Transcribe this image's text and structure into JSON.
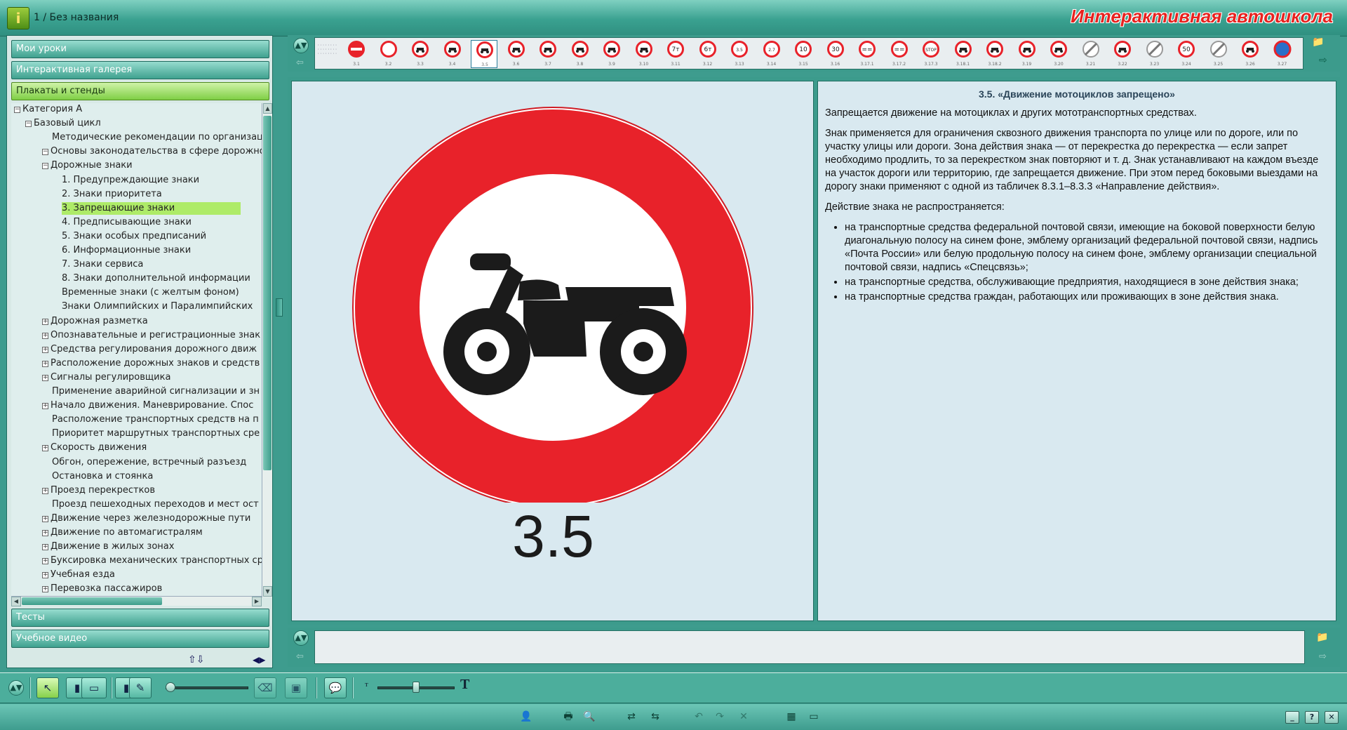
{
  "window": {
    "title": "1 / Без названия",
    "brand": "Интерактивная автошкола"
  },
  "sidebar": {
    "buttons": [
      {
        "label": "Мои уроки"
      },
      {
        "label": "Интерактивная галерея"
      },
      {
        "label": "Плакаты и стенды"
      }
    ],
    "bottom_buttons": [
      {
        "label": "Тесты"
      },
      {
        "label": "Учебное видео"
      }
    ],
    "tree": [
      {
        "label": "Категория A",
        "level": 0,
        "toggle": "minus"
      },
      {
        "label": "Базовый цикл",
        "level": 1,
        "toggle": "minus"
      },
      {
        "label": "Методические рекомендации по организации",
        "level": 2,
        "toggle": ""
      },
      {
        "label": "Основы законодательства в сфере дорожного",
        "level": 2,
        "toggle": "minus"
      },
      {
        "label": "Дорожные знаки",
        "level": 3,
        "toggle": "minus"
      },
      {
        "label": "1. Предупреждающие знаки",
        "level": 4,
        "toggle": ""
      },
      {
        "label": "2. Знаки приоритета",
        "level": 4,
        "toggle": ""
      },
      {
        "label": "3. Запрещающие знаки",
        "level": 4,
        "toggle": "",
        "selected": true
      },
      {
        "label": "4. Предписывающие знаки",
        "level": 4,
        "toggle": ""
      },
      {
        "label": "5. Знаки особых предписаний",
        "level": 4,
        "toggle": ""
      },
      {
        "label": "6. Информационные знаки",
        "level": 4,
        "toggle": ""
      },
      {
        "label": "7. Знаки сервиса",
        "level": 4,
        "toggle": ""
      },
      {
        "label": "8. Знаки дополнительной информации",
        "level": 4,
        "toggle": ""
      },
      {
        "label": "Временные знаки (с желтым фоном)",
        "level": 4,
        "toggle": ""
      },
      {
        "label": "Знаки Олимпийских и Паралимпийских",
        "level": 4,
        "toggle": ""
      },
      {
        "label": "Дорожная разметка",
        "level": 3,
        "toggle": "plus"
      },
      {
        "label": "Опознавательные и регистрационные знак",
        "level": 3,
        "toggle": "plus"
      },
      {
        "label": "Средства регулирования дорожного движ",
        "level": 3,
        "toggle": "plus"
      },
      {
        "label": "Расположение дорожных знаков и средств",
        "level": 3,
        "toggle": "plus"
      },
      {
        "label": "Сигналы регулировщика",
        "level": 3,
        "toggle": "plus"
      },
      {
        "label": "Применение аварийной сигнализации и зн",
        "level": 3,
        "toggle": ""
      },
      {
        "label": "Начало движения. Маневрирование. Спос",
        "level": 3,
        "toggle": "plus"
      },
      {
        "label": "Расположение транспортных средств на п",
        "level": 3,
        "toggle": ""
      },
      {
        "label": "Приоритет маршрутных транспортных сре",
        "level": 3,
        "toggle": ""
      },
      {
        "label": "Скорость движения",
        "level": 3,
        "toggle": "plus"
      },
      {
        "label": "Обгон, опережение, встречный разъезд",
        "level": 3,
        "toggle": ""
      },
      {
        "label": "Остановка и стоянка",
        "level": 3,
        "toggle": ""
      },
      {
        "label": "Проезд перекрестков",
        "level": 3,
        "toggle": "plus"
      },
      {
        "label": "Проезд пешеходных переходов и мест ост",
        "level": 3,
        "toggle": ""
      },
      {
        "label": "Движение через железнодорожные пути",
        "level": 3,
        "toggle": "plus"
      },
      {
        "label": "Движение по автомагистралям",
        "level": 3,
        "toggle": "plus"
      },
      {
        "label": "Движение в жилых зонах",
        "level": 3,
        "toggle": "plus"
      },
      {
        "label": "Буксировка механических транспортных ср",
        "level": 3,
        "toggle": "plus"
      },
      {
        "label": "Учебная езда",
        "level": 3,
        "toggle": "plus"
      },
      {
        "label": "Перевозка пассажиров",
        "level": 3,
        "toggle": "plus"
      }
    ]
  },
  "strip": {
    "items": [
      {
        "label": "3.1",
        "kind": "bar"
      },
      {
        "label": "3.2",
        "kind": "blank"
      },
      {
        "label": "3.3",
        "kind": "car"
      },
      {
        "label": "3.4",
        "kind": "truck"
      },
      {
        "label": "3.5",
        "kind": "moto",
        "selected": true
      },
      {
        "label": "3.6",
        "kind": "tractor"
      },
      {
        "label": "3.7",
        "kind": "trailer"
      },
      {
        "label": "3.8",
        "kind": "horse"
      },
      {
        "label": "3.9",
        "kind": "bike"
      },
      {
        "label": "3.10",
        "kind": "walk"
      },
      {
        "label": "3.11",
        "kind": "text",
        "text": "7т"
      },
      {
        "label": "3.12",
        "kind": "text",
        "text": "6т"
      },
      {
        "label": "3.13",
        "kind": "text",
        "text": "3.5"
      },
      {
        "label": "3.14",
        "kind": "text",
        "text": "2.7"
      },
      {
        "label": "3.15",
        "kind": "text",
        "text": "10"
      },
      {
        "label": "3.16",
        "kind": "text",
        "text": "30"
      },
      {
        "label": "3.17.1",
        "kind": "text",
        "text": "=="
      },
      {
        "label": "3.17.2",
        "kind": "text",
        "text": "=="
      },
      {
        "label": "3.17.3",
        "kind": "stop",
        "text": "STOP"
      },
      {
        "label": "3.18.1",
        "kind": "arrow"
      },
      {
        "label": "3.18.2",
        "kind": "arrow"
      },
      {
        "label": "3.19",
        "kind": "uturn"
      },
      {
        "label": "3.20",
        "kind": "car"
      },
      {
        "label": "3.21",
        "kind": "grey"
      },
      {
        "label": "3.22",
        "kind": "truck"
      },
      {
        "label": "3.23",
        "kind": "grey"
      },
      {
        "label": "3.24",
        "kind": "text",
        "text": "50"
      },
      {
        "label": "3.25",
        "kind": "grey"
      },
      {
        "label": "3.26",
        "kind": "horn"
      },
      {
        "label": "3.27",
        "kind": "blue"
      }
    ]
  },
  "article": {
    "sign_number": "3.5",
    "title": "3.5. «Движение мотоциклов запрещено»",
    "paragraphs": [
      "Запрещается движение на мотоциклах и других мототранспортных средствах.",
      "Знак применяется для ограничения сквозного движения транспорта по улице или по дороге, или по участку улицы или дороги. Зона действия знака — от перекрестка до перекрестка — если запрет необходимо продлить, то за перекрестком знак повторяют и т. д. Знак устанавливают на каждом въезде на участок дороги или территорию, где запрещается движение. При этом перед боковыми выездами на дорогу знаки применяют с одной из табличек 8.3.1–8.3.3 «Направление действия».",
      "Действие знака не распространяется:"
    ],
    "bullets": [
      "на транспортные средства федеральной почтовой связи, имеющие на боковой поверхности белую диагональную полосу на синем фоне, эмблему организаций федеральной почтовой связи, надпись «Почта России» или белую продольную полосу на синем фоне, эмблему организации специальной почтовой связи, надпись «Спецсвязь»;",
      "на транспортные средства, обслуживающие предприятия, находящиеся в зоне действия знака;",
      "на транспортные средства граждан, работающих или проживающих в зоне действия знака."
    ]
  },
  "toolbar": {
    "font_small": "т",
    "font_large": "T",
    "pen_slider": 0.05,
    "font_slider": 0.5
  },
  "colors": {
    "accent": "#3c9b8c",
    "sign_red": "#e8222a",
    "selected": "#aeeb68"
  }
}
